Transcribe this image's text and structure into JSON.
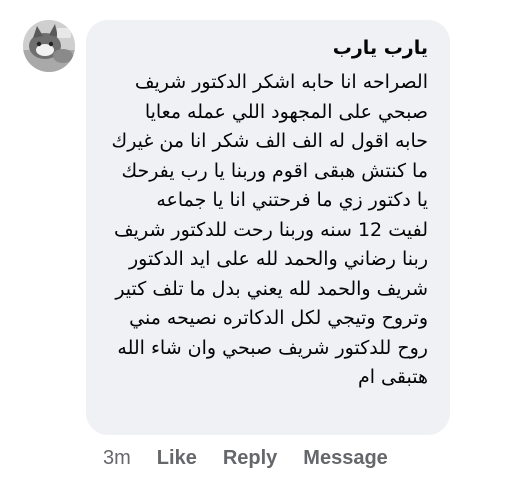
{
  "comment": {
    "author": "يارب يارب",
    "lines": [
      "الصراحه انا حابه اشكر الدكتور شريف",
      "صبحي على المجهود اللي عمله معايا",
      "حابه اقول له الف الف شكر انا من غيرك",
      "ما كنتش هبقى اقوم وربنا يا رب يفرحك",
      "يا دكتور زي ما فرحتني انا يا جماعه",
      "لفيت 12 سنه وربنا رحت للدكتور شريف",
      "ربنا رضاني والحمد لله على ايد الدكتور",
      "شريف والحمد لله يعني بدل ما تلف كتير",
      "وتروح وتيجي لكل الدكاتره نصيحه مني",
      "روح للدكتور شريف صبحي وان شاء الله",
      "هتبقى ام"
    ]
  },
  "actions": {
    "time": "3m",
    "like": "Like",
    "reply": "Reply",
    "message": "Message"
  },
  "colors": {
    "bubble": "#eff1f4",
    "text": "#050505",
    "meta": "#65676b"
  },
  "icons": {
    "avatar": "avatar-cat-photo"
  }
}
